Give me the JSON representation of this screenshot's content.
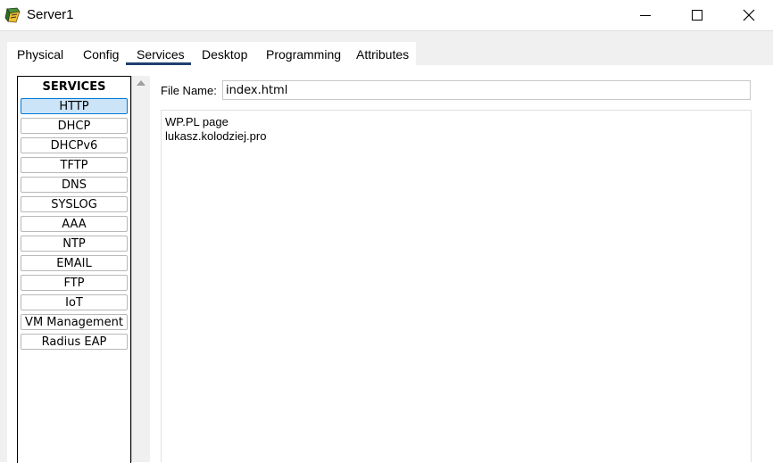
{
  "window": {
    "title": "Server1"
  },
  "tabs": [
    {
      "label": "Physical"
    },
    {
      "label": "Config"
    },
    {
      "label": "Services",
      "selected": true
    },
    {
      "label": "Desktop"
    },
    {
      "label": "Programming"
    },
    {
      "label": "Attributes"
    }
  ],
  "services": {
    "header": "SERVICES",
    "items": [
      {
        "label": "HTTP",
        "selected": true
      },
      {
        "label": "DHCP"
      },
      {
        "label": "DHCPv6"
      },
      {
        "label": "TFTP"
      },
      {
        "label": "DNS"
      },
      {
        "label": "SYSLOG"
      },
      {
        "label": "AAA"
      },
      {
        "label": "NTP"
      },
      {
        "label": "EMAIL"
      },
      {
        "label": "FTP"
      },
      {
        "label": "IoT"
      },
      {
        "label": "VM Management"
      },
      {
        "label": "Radius EAP"
      }
    ]
  },
  "editor": {
    "file_name_label": "File Name:",
    "file_name_value": "index.html",
    "content_lines": [
      "WP.PL page",
      "lukasz.kolodziej.pro"
    ]
  },
  "colors": {
    "accent": "#1f3f6f",
    "selected_bg": "#cce4f7",
    "selected_border": "#0078d7"
  },
  "icons": {
    "app": "packet-tracer-server-icon",
    "minimize": "minimize-icon",
    "maximize": "maximize-icon",
    "close": "close-icon",
    "scroll_up": "scroll-up-arrow-icon"
  }
}
